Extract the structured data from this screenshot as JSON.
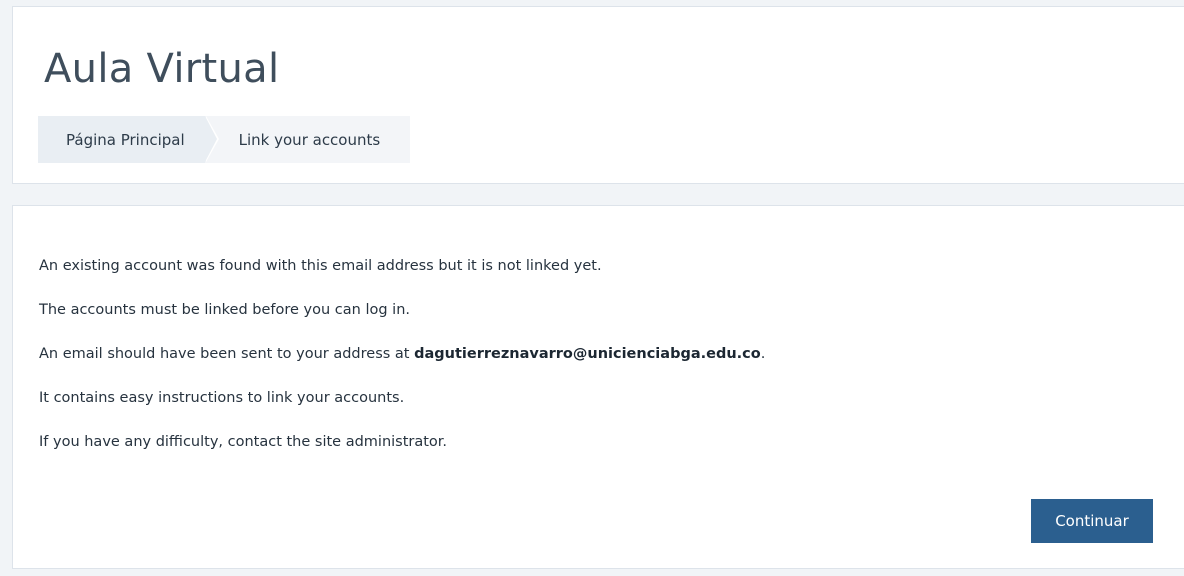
{
  "header": {
    "title": "Aula Virtual",
    "breadcrumb": {
      "home_label": "Página Principal",
      "current_label": "Link your accounts"
    }
  },
  "message": {
    "line1": "An existing account was found with this email address but it is not linked yet.",
    "line2": "The accounts must be linked before you can log in.",
    "line3_prefix": "An email should have been sent to your address at ",
    "line3_email": "dagutierreznavarro@unicienciabga.edu.co",
    "line3_suffix": ".",
    "line4": "It contains easy instructions to link your accounts.",
    "line5": "If you have any difficulty, contact the site administrator."
  },
  "actions": {
    "continue_label": "Continuar"
  },
  "colors": {
    "accent": "#2b5f8f",
    "page_background": "#f1f4f7",
    "breadcrumb_background": "#e9eef3"
  }
}
